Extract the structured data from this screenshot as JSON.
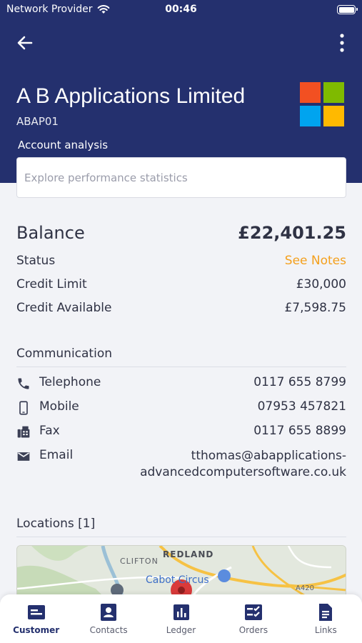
{
  "status_bar": {
    "carrier": "Network Provider",
    "time": "00:46"
  },
  "header": {
    "company_name": "A B Applications Limited",
    "company_code": "ABAP01",
    "analysis_label": "Account analysis",
    "search_placeholder": "Explore performance statistics",
    "colors": {
      "background": "#24306e"
    }
  },
  "balance": {
    "label": "Balance",
    "value": "£22,401.25",
    "rows": [
      {
        "label": "Status",
        "value": "See Notes",
        "highlight": true
      },
      {
        "label": "Credit Limit",
        "value": "£30,000"
      },
      {
        "label": "Credit Available",
        "value": "£7,598.75"
      }
    ]
  },
  "communication": {
    "title": "Communication",
    "telephone": {
      "label": "Telephone",
      "value": "0117 655 8799",
      "icon": "phone-icon"
    },
    "mobile": {
      "label": "Mobile",
      "value": "07953 457821",
      "icon": "mobile-icon"
    },
    "fax": {
      "label": "Fax",
      "value": "0117 655 8899",
      "icon": "fax-icon"
    },
    "email": {
      "label": "Email",
      "value_line1": "tthomas@abapplications-",
      "value_line2": "advancedcomputersoftware.co.uk",
      "icon": "email-icon"
    }
  },
  "locations": {
    "title": "Locations [1]",
    "map_labels": {
      "area1": "CLIFTON",
      "area2": "REDLAND",
      "poi": "Cabot Circus",
      "road": "A420"
    }
  },
  "tabs": {
    "customer": "Customer",
    "contacts": "Contacts",
    "ledger": "Ledger",
    "orders": "Orders",
    "links": "Links"
  },
  "colors": {
    "accent": "#24306e",
    "status_highlight": "#f4a01d",
    "pin": "#d93a3a"
  }
}
